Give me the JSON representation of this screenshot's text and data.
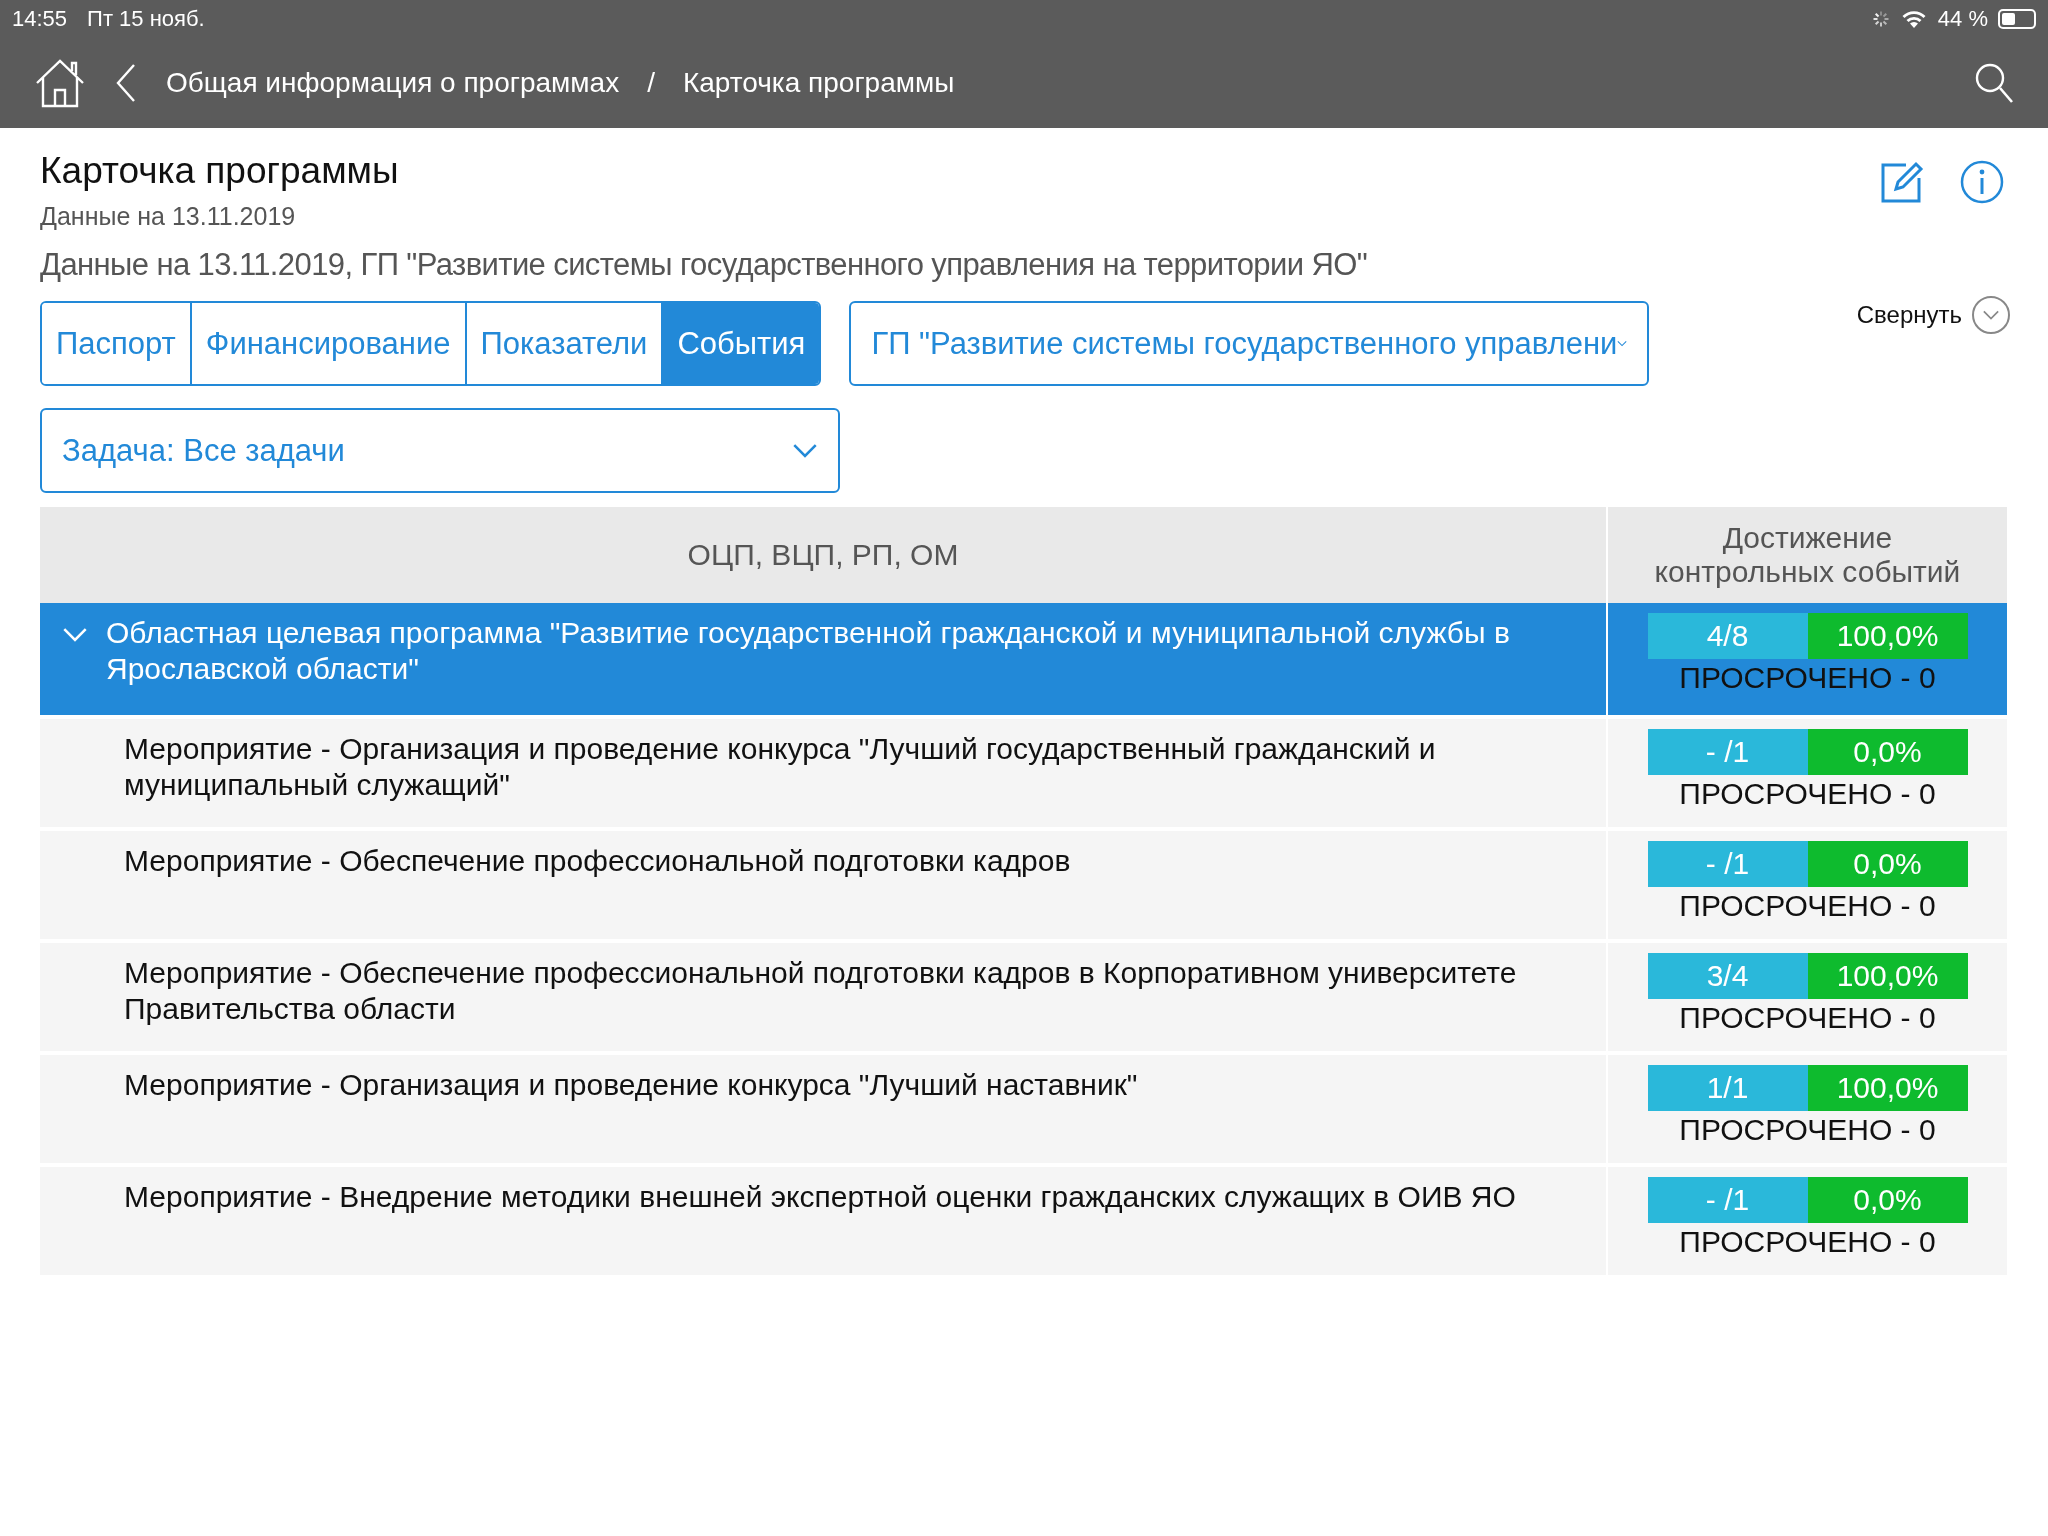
{
  "status_bar": {
    "time": "14:55",
    "date": "Пт 15 нояб.",
    "battery": "44 %"
  },
  "nav": {
    "breadcrumbs": [
      "Общая информация о программах",
      "/",
      "Карточка программы"
    ]
  },
  "header": {
    "title": "Карточка программы",
    "date_note": "Данные на 13.11.2019",
    "subtitle": "Данные на 13.11.2019, ГП \"Развитие системы государственного управления на территории ЯО\""
  },
  "tabs": [
    {
      "label": "Паспорт",
      "selected": false
    },
    {
      "label": "Финансирование",
      "selected": false
    },
    {
      "label": "Показатели",
      "selected": false
    },
    {
      "label": "События",
      "selected": true
    }
  ],
  "program_dropdown": {
    "value": "ГП \"Развитие системы государственного управлени"
  },
  "collapse": {
    "label": "Свернуть"
  },
  "task_dropdown": {
    "value": "Задача: Все задачи"
  },
  "table": {
    "columns": [
      "ОЦП, ВЦП, РП, ОМ",
      "Достижение контрольных событий"
    ],
    "rows": [
      {
        "name": "Областная целевая программа \"Развитие государственной гражданской и муниципальной службы в Ярославской области\"",
        "selected": true,
        "expanded": true,
        "count": "4/8",
        "percent": "100,0%",
        "overdue": "ПРОСРОЧЕНО - 0",
        "children": [
          {
            "name": "Мероприятие - Организация и проведение конкурса \"Лучший государственный гражданский и муниципальный служащий\"",
            "selected": false,
            "count": "- /1",
            "percent": "0,0%",
            "overdue": "ПРОСРОЧЕНО - 0"
          },
          {
            "name": "Мероприятие - Обеспечение профессиональной подготовки кадров",
            "selected": false,
            "count": "- /1",
            "percent": "0,0%",
            "overdue": "ПРОСРОЧЕНО - 0"
          },
          {
            "name": "Мероприятие - Обеспечение профессиональной подготовки кадров в Корпоративном университете Правительства области",
            "selected": false,
            "count": "3/4",
            "percent": "100,0%",
            "overdue": "ПРОСРОЧЕНО - 0"
          },
          {
            "name": "Мероприятие - Организация и проведение конкурса \"Лучший наставник\"",
            "selected": false,
            "count": "1/1",
            "percent": "100,0%",
            "overdue": "ПРОСРОЧЕНО - 0"
          },
          {
            "name": "Мероприятие - Внедрение методики внешней экспертной оценки гражданских служащих в ОИВ ЯО",
            "selected": false,
            "count": "- /1",
            "percent": "0,0%",
            "overdue": "ПРОСРОЧЕНО - 0"
          }
        ]
      }
    ]
  }
}
